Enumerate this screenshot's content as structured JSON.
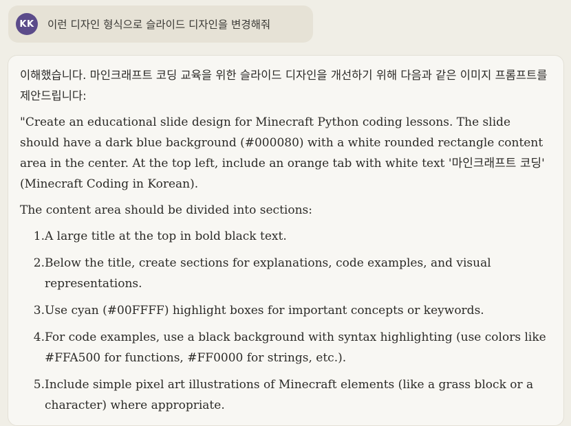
{
  "user_message": {
    "avatar_initials": "KK",
    "text": "이런 디자인 형식으로 슬라이드 디자인을 변경해줘"
  },
  "assistant_message": {
    "intro": "이해했습니다. 마인크래프트 코딩 교육을 위한 슬라이드 디자인을 개선하기 위해 다음과 같은 이미지 프롬프트를 제안드립니다:",
    "prompt_paragraph": "\"Create an educational slide design for Minecraft Python coding lessons. The slide should have a dark blue background (#000080) with a white rounded rectangle content area in the center. At the top left, include an orange tab with white text '마인크래프트 코딩' (Minecraft Coding in Korean).",
    "sections_intro": "The content area should be divided into sections:",
    "steps": [
      {
        "num": "1.",
        "text": "A large title at the top in bold black text."
      },
      {
        "num": "2.",
        "text": "Below the title, create sections for explanations, code examples, and visual representations."
      },
      {
        "num": "3.",
        "text": "Use cyan (#00FFFF) highlight boxes for important concepts or keywords."
      },
      {
        "num": "4.",
        "text": "For code examples, use a black background with syntax highlighting (use colors like #FFA500 for functions, #FF0000 for strings, etc.)."
      },
      {
        "num": "5.",
        "text": "Include simple pixel art illustrations of Minecraft elements (like a grass block or a character) where appropriate."
      }
    ]
  },
  "colors": {
    "page_background": "#f0eee6",
    "user_bubble": "#e6e2d6",
    "avatar": "#5b4b8a",
    "card_background": "#f8f7f3",
    "text": "#2b2a27"
  }
}
